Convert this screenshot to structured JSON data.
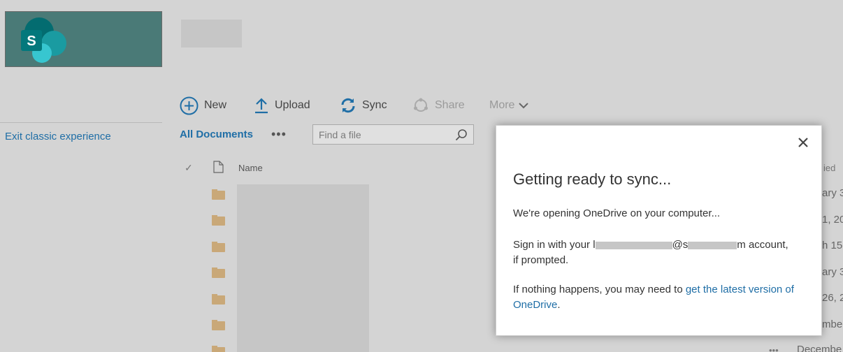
{
  "site": {
    "logo_letter": "S"
  },
  "left_nav": {
    "exit_label": "Exit classic experience"
  },
  "toolbar": {
    "new_label": "New",
    "upload_label": "Upload",
    "sync_label": "Sync",
    "share_label": "Share",
    "more_label": "More"
  },
  "view": {
    "tab_label": "All Documents",
    "ellipsis": "•••",
    "search_placeholder": "Find a file"
  },
  "list": {
    "columns": {
      "check": "✓",
      "name": "Name",
      "modified_partial": "ied"
    },
    "modified_fragments": [
      "ary 3",
      "1, 20",
      "h 15",
      "ary 3",
      "26, 2",
      "mbe"
    ],
    "modified_last": "Decembe",
    "row_ellipsis": "•••"
  },
  "dialog": {
    "title": "Getting ready to sync...",
    "line1": "We're opening OneDrive on your computer...",
    "line2_a": "Sign in with your l",
    "line2_b": "@s",
    "line2_c": "m account,",
    "line2_d": "if prompted.",
    "line3_a": "If nothing happens, you may need to ",
    "line3_link": "get the latest version of OneDrive",
    "line3_end": "."
  }
}
